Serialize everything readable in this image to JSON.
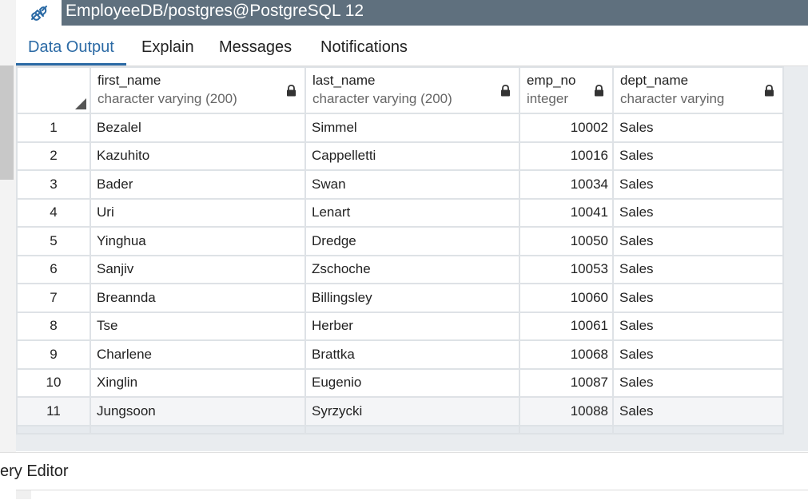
{
  "window": {
    "connection_title": "EmployeeDB/postgres@PostgreSQL 12"
  },
  "tabs": [
    {
      "label": "Data Output",
      "active": true
    },
    {
      "label": "Explain",
      "active": false
    },
    {
      "label": "Messages",
      "active": false
    },
    {
      "label": "Notifications",
      "active": false
    }
  ],
  "columns": [
    {
      "name": "first_name",
      "type": "character varying (200)",
      "locked": true
    },
    {
      "name": "last_name",
      "type": "character varying (200)",
      "locked": true
    },
    {
      "name": "emp_no",
      "type": "integer",
      "locked": true
    },
    {
      "name": "dept_name",
      "type": "character varying",
      "locked": true
    }
  ],
  "rows": [
    {
      "n": "1",
      "first_name": "Bezalel",
      "last_name": "Simmel",
      "emp_no": "10002",
      "dept_name": "Sales"
    },
    {
      "n": "2",
      "first_name": "Kazuhito",
      "last_name": "Cappelletti",
      "emp_no": "10016",
      "dept_name": "Sales"
    },
    {
      "n": "3",
      "first_name": "Bader",
      "last_name": "Swan",
      "emp_no": "10034",
      "dept_name": "Sales"
    },
    {
      "n": "4",
      "first_name": "Uri",
      "last_name": "Lenart",
      "emp_no": "10041",
      "dept_name": "Sales"
    },
    {
      "n": "5",
      "first_name": "Yinghua",
      "last_name": "Dredge",
      "emp_no": "10050",
      "dept_name": "Sales"
    },
    {
      "n": "6",
      "first_name": "Sanjiv",
      "last_name": "Zschoche",
      "emp_no": "10053",
      "dept_name": "Sales"
    },
    {
      "n": "7",
      "first_name": "Breannda",
      "last_name": "Billingsley",
      "emp_no": "10060",
      "dept_name": "Sales"
    },
    {
      "n": "8",
      "first_name": "Tse",
      "last_name": "Herber",
      "emp_no": "10061",
      "dept_name": "Sales"
    },
    {
      "n": "9",
      "first_name": "Charlene",
      "last_name": "Brattka",
      "emp_no": "10068",
      "dept_name": "Sales"
    },
    {
      "n": "10",
      "first_name": "Xinglin",
      "last_name": "Eugenio",
      "emp_no": "10087",
      "dept_name": "Sales"
    },
    {
      "n": "11",
      "first_name": "Jungsoon",
      "last_name": "Syrzycki",
      "emp_no": "10088",
      "dept_name": "Sales"
    }
  ],
  "bottom_panel": {
    "tab_label": "ery Editor"
  },
  "icons": {
    "connection": "connection-plug-icon",
    "lock": "lock-icon",
    "corner": "select-all-corner-icon"
  },
  "colors": {
    "titlebar": "#5f707e",
    "active_tab": "#2b6aa5",
    "grid_border": "#dee2e6"
  }
}
